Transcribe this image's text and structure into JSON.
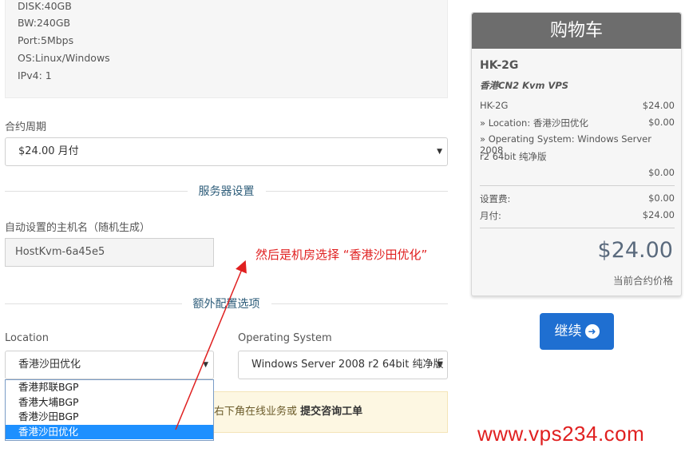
{
  "specs": [
    "DISK:40GB",
    "BW:240GB",
    "Port:5Mbps",
    "OS:Linux/Windows",
    "IPv4: 1"
  ],
  "billing": {
    "label": "合约周期",
    "value": "$24.00 月付"
  },
  "server_section": {
    "title": "服务器设置",
    "hostname_label": "自动设置的主机名（随机生成）",
    "hostname_value": "HostKvm-6a45e5"
  },
  "annotation": "然后是机房选择 “香港沙田优化”",
  "options_section": {
    "title": "额外配置选项",
    "location_label": "Location",
    "location_value": "香港沙田优化",
    "os_label": "Operating System",
    "os_value": "Windows Server 2008 r2 64bit 纯净版"
  },
  "location_options": [
    "香港邦联BGP",
    "香港大埔BGP",
    "香港沙田BGP",
    "香港沙田优化"
  ],
  "notice": {
    "text": "右下角在线业务或 ",
    "link": "提交咨询工单"
  },
  "cart": {
    "title": "购物车",
    "product": "HK-2G",
    "group": "香港CN2 Kvm VPS",
    "lines": [
      {
        "label": "HK-2G",
        "price": "$24.00"
      },
      {
        "label": "» Location: 香港沙田优化",
        "price": "$0.00"
      },
      {
        "label": "» Operating System: Windows Server 2008",
        "price": ""
      },
      {
        "label": "r2 64bit 纯净版",
        "price": ""
      },
      {
        "label": "",
        "price": "$0.00"
      }
    ],
    "setup_label": "设置费:",
    "setup_price": "$0.00",
    "monthly_label": "月付:",
    "monthly_price": "$24.00",
    "total": "$24.00",
    "total_label": "当前合约价格"
  },
  "continue_label": "继续",
  "watermark": "www.vps234.com",
  "colors": {
    "accent": "#1f6fd1",
    "annotation": "#e02020",
    "cart_header": "#6d6d6d",
    "dropdown_selected": "#1e90ff"
  }
}
